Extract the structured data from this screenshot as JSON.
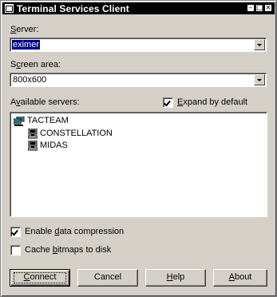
{
  "window": {
    "title": "Terminal Services Client",
    "buttons": [
      "minimize",
      "maximize",
      "close"
    ]
  },
  "server": {
    "label_key": "S",
    "label_rest": "erver:",
    "value": "eximer"
  },
  "screen_area": {
    "label_pre": "S",
    "label_key": "c",
    "label_rest": "reen area:",
    "value": "800x600"
  },
  "available_servers": {
    "label_pre": "A",
    "label_key": "v",
    "label_rest": "ailable servers:"
  },
  "expand_by_default": {
    "checked": true,
    "label_key": "E",
    "label_rest": "xpand by default"
  },
  "server_tree": {
    "domain": {
      "label": "TACTEAM",
      "icon": "network-domain-icon"
    },
    "servers": [
      {
        "label": "CONSTELLATION",
        "icon": "computer-icon"
      },
      {
        "label": "MIDAS",
        "icon": "computer-icon"
      }
    ]
  },
  "options": {
    "data_compression": {
      "checked": true,
      "label_pre": "Enable ",
      "label_key": "d",
      "label_rest": "ata compression"
    },
    "cache_bitmaps": {
      "checked": false,
      "label_pre": "Cache ",
      "label_key": "b",
      "label_rest": "itmaps to disk"
    }
  },
  "buttons": {
    "connect": {
      "label_key": "C",
      "label_rest": "onnect"
    },
    "cancel": {
      "label": "Cancel"
    },
    "help": {
      "label_key": "H",
      "label_rest": "elp"
    },
    "about": {
      "label_key": "A",
      "label_rest": "bout"
    }
  },
  "colors": {
    "face": "#d4d0c8",
    "titlebar": "#000000",
    "selection": "#000080"
  }
}
